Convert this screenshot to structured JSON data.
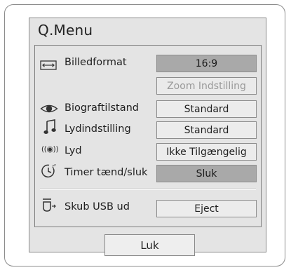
{
  "dialog": {
    "title": "Q.Menu",
    "close_label": "Luk"
  },
  "menu": {
    "aspect": {
      "label": "Billedformat",
      "value": "16:9",
      "sub_value": "Zoom Indstilling",
      "icon": "aspect-ratio-icon"
    },
    "picture": {
      "label": "Biograftilstand",
      "value": "Standard",
      "icon": "eye-icon"
    },
    "sound_mode": {
      "label": "Lydindstilling",
      "value": "Standard",
      "icon": "music-note-icon"
    },
    "audio": {
      "label": "Lyd",
      "value": "Ikke Tilgængelig",
      "icon": "audio-waves-icon",
      "glyph": "((◉))"
    },
    "timer": {
      "label": "Timer tænd/sluk",
      "value": "Sluk",
      "icon": "clock-timer-icon"
    },
    "usb": {
      "label": "Skub USB ud",
      "value": "Eject",
      "icon": "usb-eject-icon"
    }
  },
  "colors": {
    "selected_button": "#a9a9a9",
    "button": "#ececec",
    "panel": "#e4e4e4"
  }
}
